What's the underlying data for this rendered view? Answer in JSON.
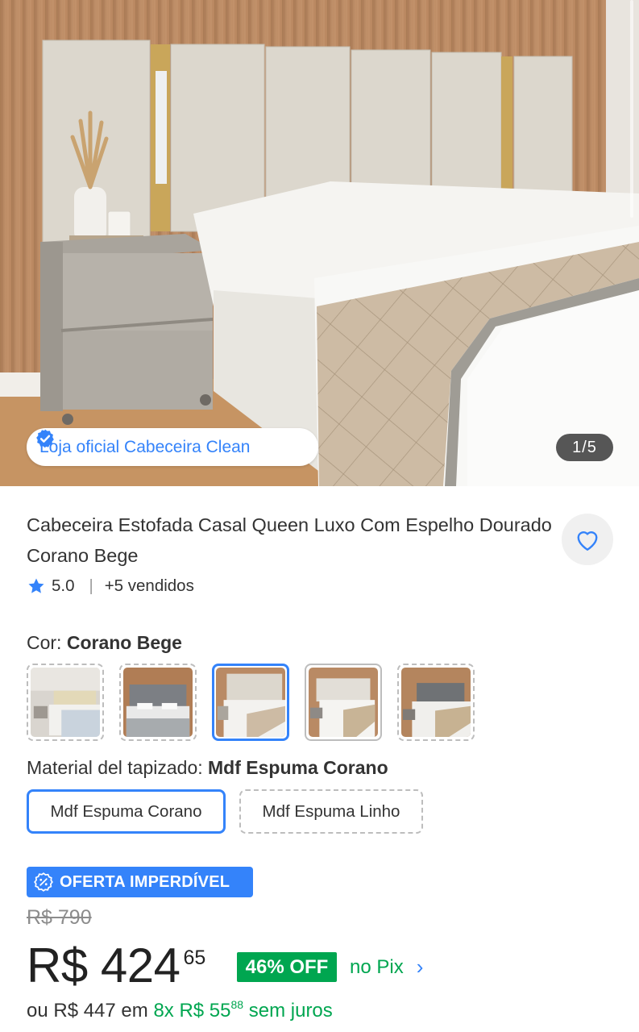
{
  "gallery": {
    "store_badge": "Loja oficial Cabeceira Clean",
    "counter": "1/5"
  },
  "product": {
    "title": "Cabeceira Estofada Casal Queen Luxo Com Espelho Dourado Corano Bege",
    "rating": "5.0",
    "sold": "+5 vendidos"
  },
  "color": {
    "label": "Cor:",
    "selected": "Corano Bege",
    "thumbnail_count": 5,
    "selected_index": 2
  },
  "material": {
    "label": "Material del tapizado:",
    "selected": "Mdf Espuma Corano",
    "options": [
      "Mdf Espuma Corano",
      "Mdf Espuma Linho"
    ]
  },
  "pricing": {
    "offer_badge": "OFERTA IMPERDÍVEL",
    "old_price": "R$ 790",
    "price_main": "R$ 424",
    "price_cents": "65",
    "discount": "46% OFF",
    "pix_label": "no Pix",
    "installments_prefix": "ou R$ 447 em",
    "installments_plan": "8x R$ 55",
    "installments_cents": "88",
    "installments_suffix": "sem juros"
  },
  "colors": {
    "accent": "#3483fa",
    "green": "#00a650",
    "wood": "#b98a64",
    "panel": "#dcd7cd"
  }
}
